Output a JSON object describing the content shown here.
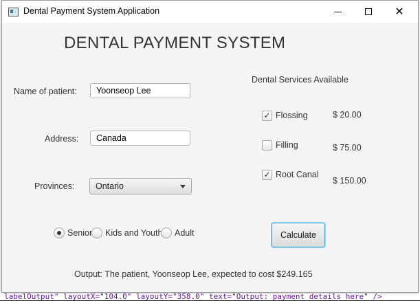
{
  "window": {
    "title": "Dental Payment System Application"
  },
  "heading": "DENTAL PAYMENT SYSTEM",
  "form": {
    "name_label": "Name of patient:",
    "name_value": "Yoonseop Lee",
    "address_label": "Address:",
    "address_value": "Canada",
    "province_label": "Provinces:",
    "province_value": "Ontario"
  },
  "services": {
    "header": "Dental Services Available",
    "items": [
      {
        "label": "Flossing",
        "price": "$ 20.00",
        "checked": true
      },
      {
        "label": "Filling",
        "price": "$ 75.00",
        "checked": false
      },
      {
        "label": "Root Canal",
        "price": "$ 150.00",
        "checked": true
      }
    ]
  },
  "age_group": {
    "options": [
      "Senior",
      "Kids and Youth",
      "Adult"
    ],
    "selected": "Senior"
  },
  "calculate_label": "Calculate",
  "output_text": "Output: The patient, Yoonseop Lee, expected to cost $249.165",
  "background_code": {
    "bottom_line": "labelOutput\" layoutX=\"104.0\" layoutY=\"358.0\" text=\"Output: payment details here\" />"
  },
  "colors": {
    "focus_border": "#3a9fd8",
    "window_bg": "#f4f4f4",
    "code_purple": "#6a1b9a"
  }
}
